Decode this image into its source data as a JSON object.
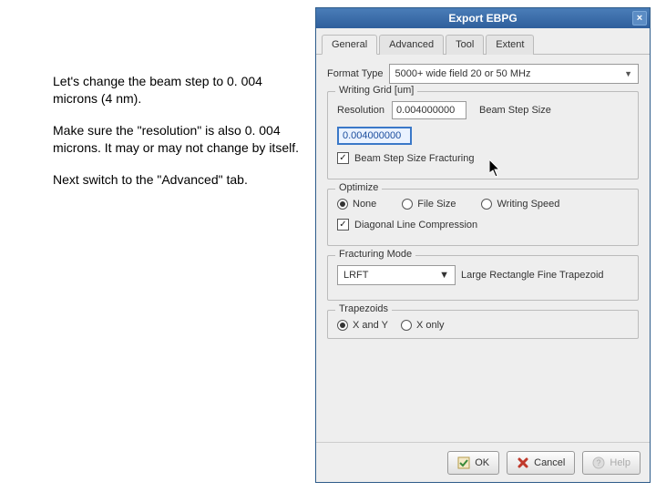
{
  "instructions": {
    "p1": "Let's change the beam step to 0. 004 microns (4 nm).",
    "p2": "Make sure the \"resolution\" is also 0. 004 microns. It may or may not change by itself.",
    "p3": "Next switch to the \"Advanced\" tab."
  },
  "window": {
    "title": "Export EBPG",
    "close": "×"
  },
  "tabs": {
    "general": "General",
    "advanced": "Advanced",
    "tool": "Tool",
    "extent": "Extent"
  },
  "format": {
    "label": "Format Type",
    "value": "5000+ wide field 20 or 50 MHz",
    "arrow": "▼"
  },
  "writing_grid": {
    "title": "Writing Grid [um]",
    "resolution_label": "Resolution",
    "resolution_value": "0.004000000",
    "beam_step_label": "Beam Step Size",
    "beam_step_value": "0.004000000",
    "bsf_label": "Beam Step Size Fracturing"
  },
  "optimize": {
    "title": "Optimize",
    "none": "None",
    "file_size": "File Size",
    "writing_speed": "Writing Speed",
    "diagonal": "Diagonal Line Compression"
  },
  "fracturing": {
    "title": "Fracturing Mode",
    "value": "LRFT",
    "arrow": "▼",
    "desc": "Large Rectangle Fine Trapezoid"
  },
  "trapezoids": {
    "title": "Trapezoids",
    "xy": "X and Y",
    "xonly": "X only"
  },
  "buttons": {
    "ok": "OK",
    "cancel": "Cancel",
    "help": "Help"
  }
}
